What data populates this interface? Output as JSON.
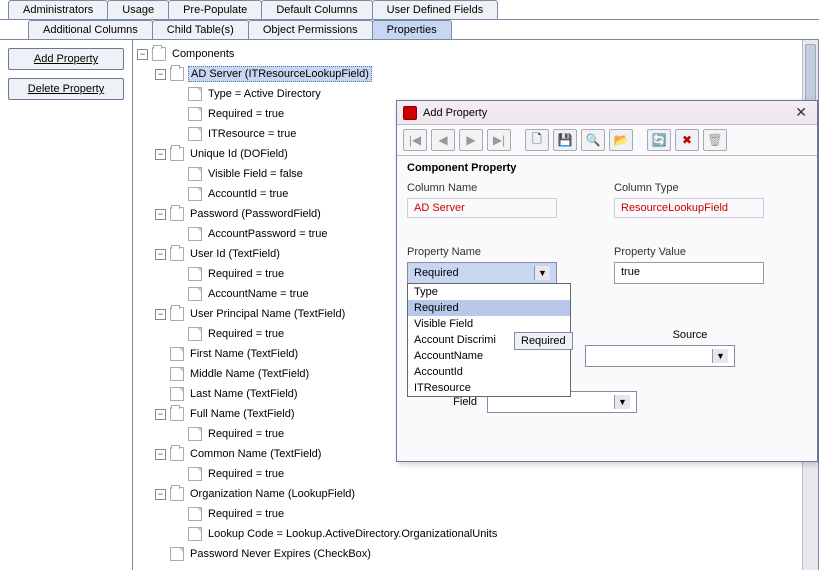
{
  "tabsRow1": {
    "administrators": "Administrators",
    "usage": "Usage",
    "prepopulate": "Pre-Populate",
    "defaultcolumns": "Default Columns",
    "userdefined": "User Defined Fields"
  },
  "tabsRow2": {
    "additionalcolumns": "Additional Columns",
    "childtables": "Child Table(s)",
    "objectpermissions": "Object Permissions",
    "properties": "Properties"
  },
  "buttons": {
    "add": "Add Property",
    "delete": "Delete Property"
  },
  "tree": {
    "root": "Components",
    "adserver": {
      "label": "AD Server (ITResourceLookupField)",
      "type": "Type = Active Directory",
      "required": "Required = true",
      "itresource": "ITResource = true"
    },
    "uniqueid": {
      "label": "Unique Id (DOField)",
      "visible": "Visible Field = false",
      "accountid": "AccountId = true"
    },
    "password": {
      "label": "Password (PasswordField)",
      "acctpw": "AccountPassword = true"
    },
    "userid": {
      "label": "User Id (TextField)",
      "required": "Required = true",
      "accountname": "AccountName = true"
    },
    "upn": {
      "label": "User Principal Name (TextField)",
      "required": "Required = true"
    },
    "firstname": "First Name (TextField)",
    "middlename": "Middle Name (TextField)",
    "lastname": "Last Name (TextField)",
    "fullname": {
      "label": "Full Name (TextField)",
      "required": "Required = true"
    },
    "commonname": {
      "label": "Common Name (TextField)",
      "required": "Required = true"
    },
    "orgname": {
      "label": "Organization Name (LookupField)",
      "required": "Required = true",
      "lookup": "Lookup Code = Lookup.ActiveDirectory.OrganizationalUnits"
    },
    "pwdnever": "Password Never Expires (CheckBox)"
  },
  "dialog": {
    "title": "Add Property",
    "section": "Component Property",
    "colname_lbl": "Column Name",
    "coltype_lbl": "Column Type",
    "colname_val": "AD Server",
    "coltype_val": "ResourceLookupField",
    "propname_lbl": "Property Name",
    "propval_lbl": "Property Value",
    "propname_val": "Required",
    "propval_val": "true",
    "source_lbl": "Source",
    "field_lbl": "Field",
    "options": {
      "o0": "Type",
      "o1": "Required",
      "o2": "Visible Field",
      "o3": "Account Discrimi",
      "o4": "AccountName",
      "o5": "AccountId",
      "o6": "ITResource"
    },
    "tooltip": "Required"
  },
  "glyphs": {
    "minus": "−",
    "first": "|◀",
    "prev": "◀",
    "next": "▶",
    "last": "▶|",
    "new": "🗋",
    "save": "💾",
    "find": "🔍",
    "props": "📂",
    "refresh": "🔄",
    "delete": "✖",
    "trash": "🗑",
    "close": "✕",
    "caret": "▼"
  }
}
